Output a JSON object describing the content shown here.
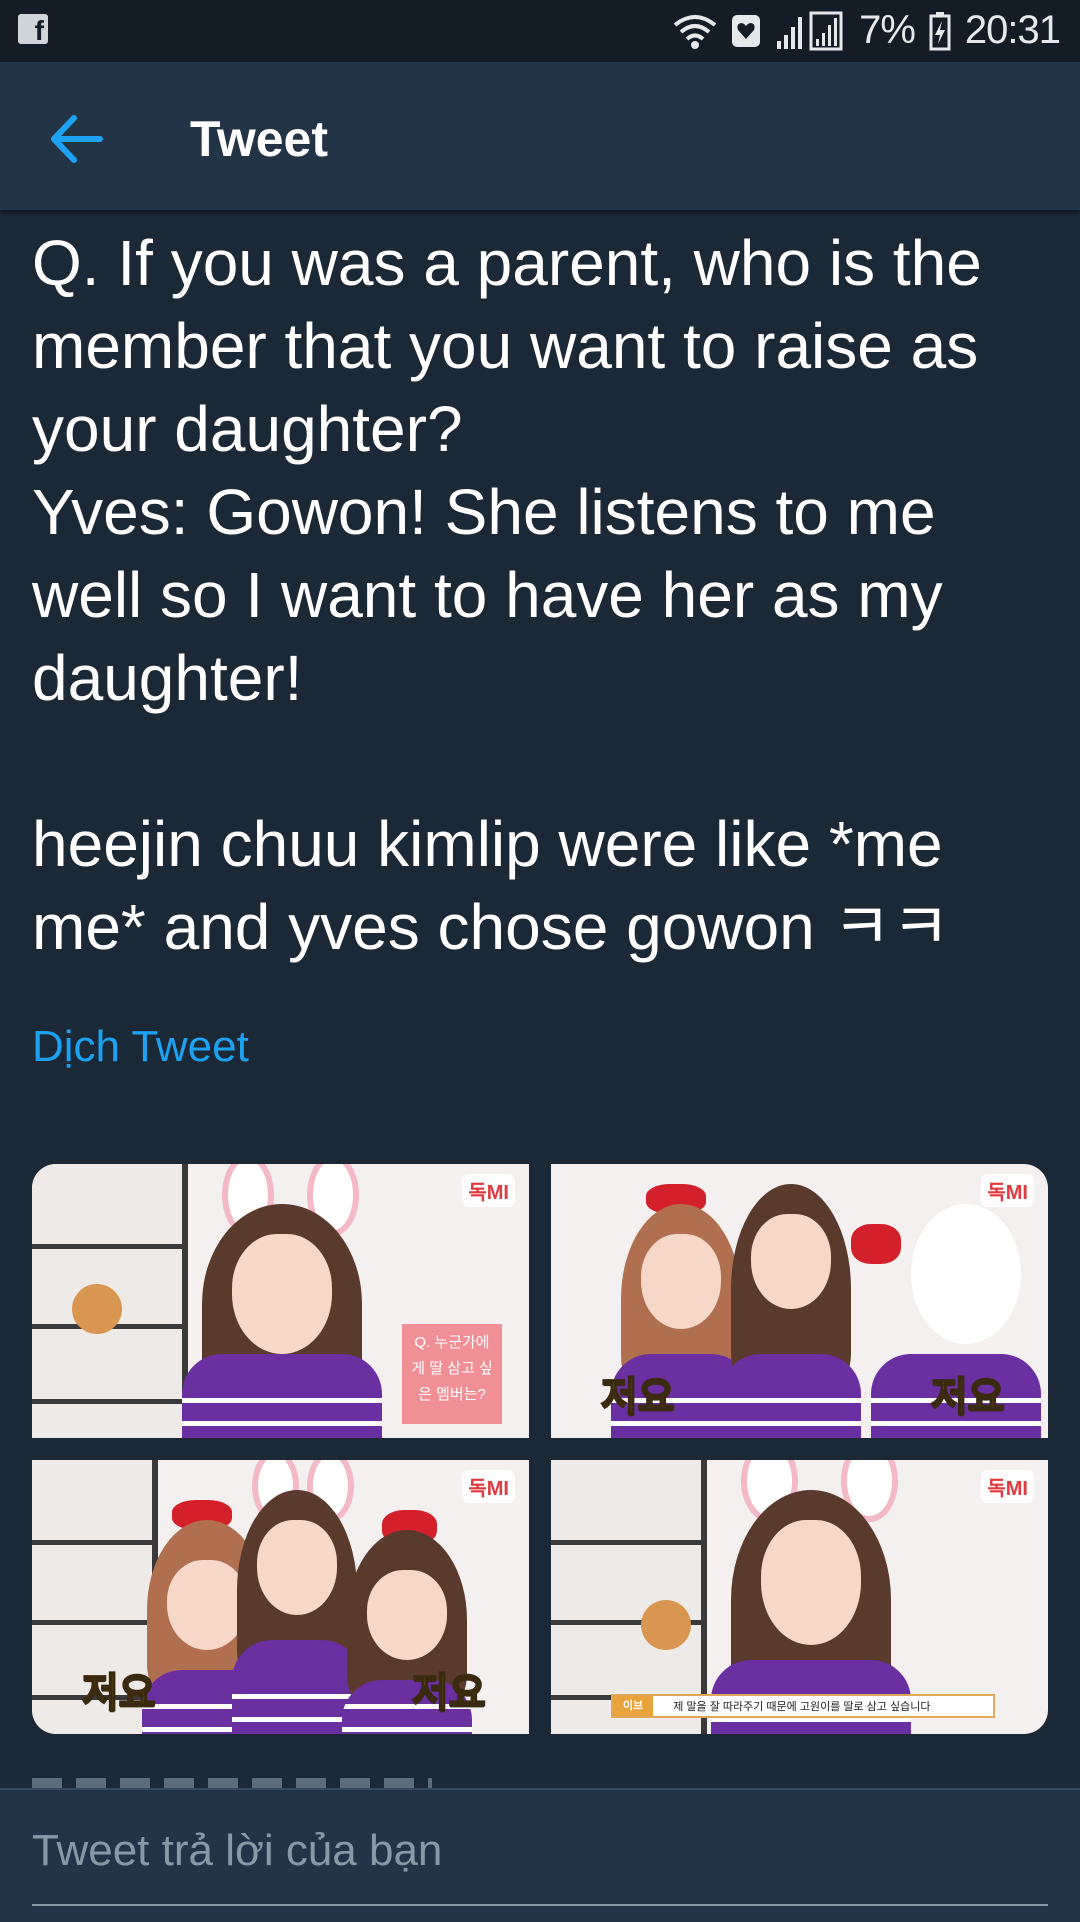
{
  "status_bar": {
    "battery": "7%",
    "time": "20:31"
  },
  "toolbar": {
    "title": "Tweet"
  },
  "tweet": {
    "text": "Q. If you was a parent, who is the\nmember that you want to raise as\nyour daughter?\nYves: Gowon! She listens to me\nwell so I want to have her as my\ndaughter!\n\nheejin chuu kimlip were like *me\nme* and yves chose gowon ㅋㅋ",
    "translate_label": "Dịch Tweet",
    "media": [
      {
        "logo": "독MI",
        "sign_text": "Q. 누군가에게 딸 삼고 싶은 멤버는?"
      },
      {
        "logo": "독MI",
        "overlay_left": "저요",
        "overlay_right": "저요"
      },
      {
        "logo": "독MI",
        "overlay_left": "저요",
        "overlay_right": "저요"
      },
      {
        "logo": "독MI",
        "subtitle_name": "이브",
        "subtitle_text": "제 말을 잘 따라주기 때문에 고원이를 딸로 삼고 싶습니다"
      }
    ]
  },
  "reply": {
    "placeholder": "Tweet trả lời của bạn"
  },
  "colors": {
    "background": "#1b2836",
    "toolbar": "#243447",
    "accent": "#1da1f2",
    "placeholder": "#8899a6"
  }
}
